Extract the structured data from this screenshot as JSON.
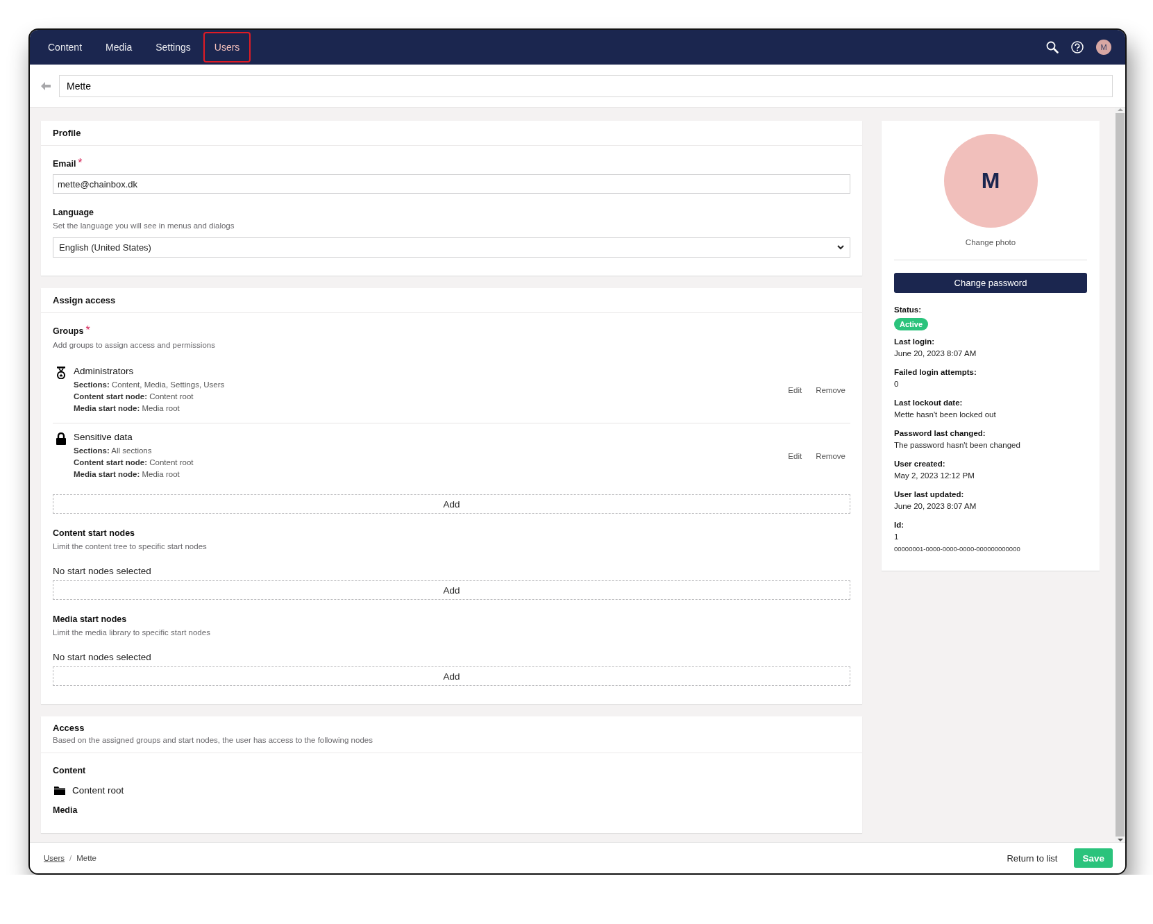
{
  "nav": {
    "tabs": [
      {
        "label": "Content",
        "selected": false,
        "highlighted": false
      },
      {
        "label": "Media",
        "selected": false,
        "highlighted": false
      },
      {
        "label": "Settings",
        "selected": false,
        "highlighted": false
      },
      {
        "label": "Users",
        "selected": true,
        "highlighted": true
      }
    ],
    "avatar_initial": "M"
  },
  "header": {
    "name": "Mette"
  },
  "profile": {
    "title": "Profile",
    "email": {
      "label": "Email",
      "required_mark": "*",
      "value": "mette@chainbox.dk"
    },
    "language": {
      "label": "Language",
      "description": "Set the language you will see in menus and dialogs",
      "value": "English (United States)"
    }
  },
  "assign_access": {
    "title": "Assign access",
    "groups": {
      "label": "Groups",
      "required_mark": "*",
      "description": "Add groups to assign access and permissions",
      "items": [
        {
          "name": "Administrators",
          "kind": "medal",
          "details": [
            {
              "label": "Sections:",
              "value": "Content, Media, Settings, Users"
            },
            {
              "label": "Content start node:",
              "value": "Content root"
            },
            {
              "label": "Media start node:",
              "value": "Media root"
            }
          ],
          "actions": [
            "Edit",
            "Remove"
          ]
        },
        {
          "name": "Sensitive data",
          "kind": "lock",
          "details": [
            {
              "label": "Sections:",
              "value": "All sections"
            },
            {
              "label": "Content start node:",
              "value": "Content root"
            },
            {
              "label": "Media start node:",
              "value": "Media root"
            }
          ],
          "actions": [
            "Edit",
            "Remove"
          ]
        }
      ],
      "add_button": "Add"
    },
    "start_nodes": [
      {
        "label": "Content start nodes",
        "description": "Limit the content tree to specific start nodes",
        "empty_text": "No start nodes selected",
        "add_button": "Add"
      },
      {
        "label": "Media start nodes",
        "description": "Limit the media library to specific start nodes",
        "empty_text": "No start nodes selected",
        "add_button": "Add"
      }
    ]
  },
  "access": {
    "title": "Access",
    "description": "Based on the assigned groups and start nodes, the user has access to the following nodes",
    "sections": [
      {
        "label": "Content",
        "items": [
          {
            "name": "Content root",
            "kind": "folder"
          }
        ]
      },
      {
        "label": "Media"
      }
    ]
  },
  "user_panel": {
    "avatar_initial": "M",
    "change_photo": "Change photo",
    "change_password": "Change password",
    "status": {
      "label": "Status:",
      "value": "Active"
    },
    "fields": [
      {
        "label": "Last login:",
        "value": "June 20, 2023 8:07 AM"
      },
      {
        "label": "Failed login attempts:",
        "value": "0"
      },
      {
        "label": "Last lockout date:",
        "value": "Mette hasn't been locked out"
      },
      {
        "label": "Password last changed:",
        "value": "The password hasn't been changed"
      },
      {
        "label": "User created:",
        "value": "May 2, 2023 12:12 PM"
      },
      {
        "label": "User last updated:",
        "value": "June 20, 2023 8:07 AM"
      }
    ],
    "id": {
      "label": "Id:",
      "value": "1",
      "key": "00000001-0000-0000-0000-000000000000"
    }
  },
  "footer": {
    "breadcrumb": [
      {
        "label": "Users",
        "link": true
      },
      {
        "label": "Mette",
        "link": false
      }
    ],
    "breadcrumb_separator": "/",
    "return_button": "Return to list",
    "save_button": "Save"
  }
}
